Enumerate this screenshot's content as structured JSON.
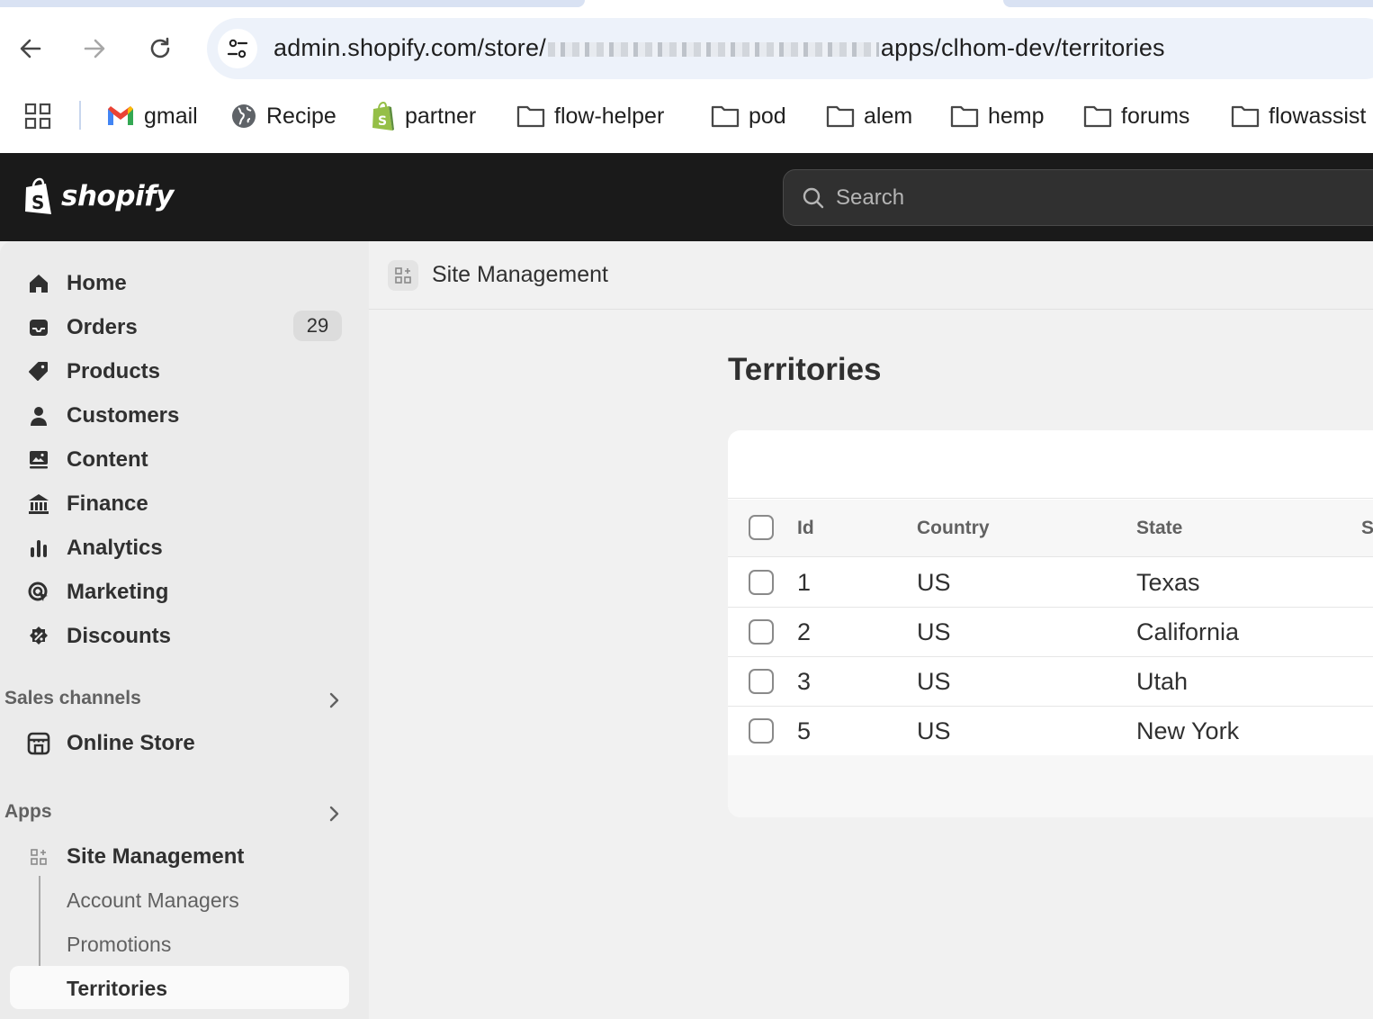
{
  "browser": {
    "url_prefix": "admin.shopify.com/store/",
    "url_suffix": "apps/clhom-dev/territories",
    "bookmarks": [
      "gmail",
      "Recipe",
      "partner",
      "flow-helper",
      "pod",
      "alem",
      "hemp",
      "forums",
      "flowassist"
    ]
  },
  "topbar": {
    "logo_text": "shopify",
    "search_placeholder": "Search"
  },
  "sidebar": {
    "items": [
      {
        "label": "Home",
        "icon": "home-icon"
      },
      {
        "label": "Orders",
        "icon": "inbox-icon",
        "badge": "29"
      },
      {
        "label": "Products",
        "icon": "tag-icon"
      },
      {
        "label": "Customers",
        "icon": "person-icon"
      },
      {
        "label": "Content",
        "icon": "content-icon"
      },
      {
        "label": "Finance",
        "icon": "bank-icon"
      },
      {
        "label": "Analytics",
        "icon": "bar-chart-icon"
      },
      {
        "label": "Marketing",
        "icon": "target-icon"
      },
      {
        "label": "Discounts",
        "icon": "discount-icon"
      }
    ],
    "sales_channels": {
      "heading": "Sales channels",
      "items": [
        "Online Store"
      ]
    },
    "apps": {
      "heading": "Apps",
      "app_name": "Site Management",
      "sub_items": [
        "Account Managers",
        "Promotions",
        "Territories"
      ],
      "active": "Territories"
    }
  },
  "main": {
    "app_title": "Site Management",
    "page_title": "Territories",
    "table": {
      "columns": [
        "Id",
        "Country",
        "State",
        "S"
      ],
      "rows": [
        {
          "id": "1",
          "country": "US",
          "state": "Texas"
        },
        {
          "id": "2",
          "country": "US",
          "state": "California"
        },
        {
          "id": "3",
          "country": "US",
          "state": "Utah"
        },
        {
          "id": "5",
          "country": "US",
          "state": "New York"
        }
      ]
    }
  }
}
